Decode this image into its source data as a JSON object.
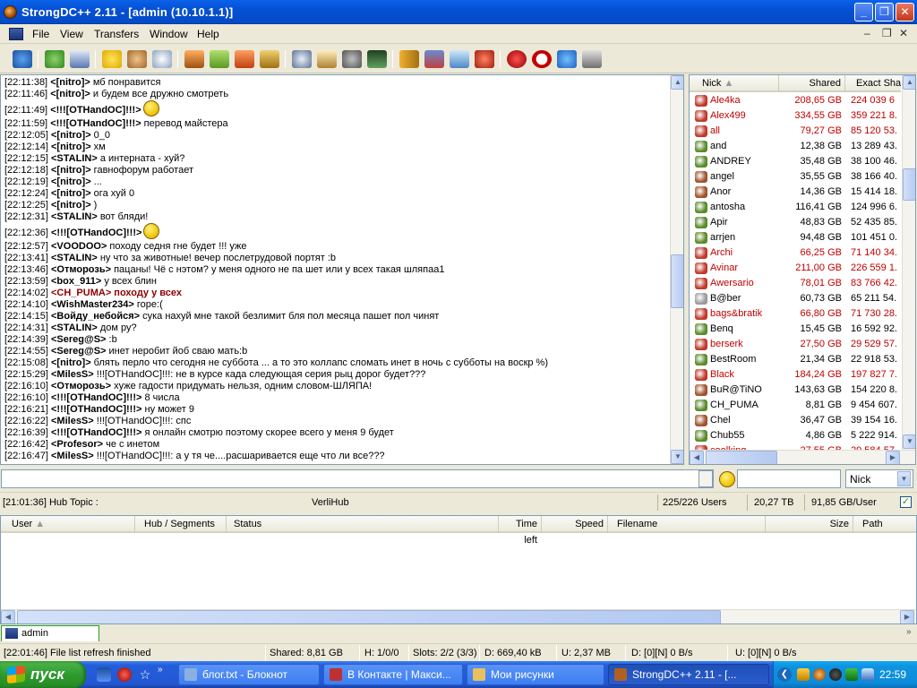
{
  "window": {
    "title": "StrongDC++ 2.11 - [admin (10.10.1.1)]",
    "controls": {
      "minimize": "_",
      "maximize": "❐",
      "close": "✕"
    }
  },
  "menu": {
    "items": [
      "File",
      "View",
      "Transfers",
      "Window",
      "Help"
    ],
    "mdi_controls": {
      "minimize": "–",
      "restore": "❐",
      "close": "✕"
    }
  },
  "toolbar": {
    "icons": [
      "connect-icon",
      "reconnect-icon",
      "follow-redirect-icon",
      "favorites-icon",
      "users-icon",
      "recents-icon",
      "queue-icon",
      "finished-icon",
      "uploads-icon",
      "finished-uploads-icon",
      "search-icon",
      "adl-search-icon",
      "search-spy-icon",
      "notepad-icon",
      "open-list-icon",
      "refresh-icon",
      "settings-icon",
      "network-stats-icon",
      "away-icon",
      "limiter-icon",
      "sysinfo-icon",
      "cdm-icon"
    ]
  },
  "chat": {
    "lines": [
      {
        "time": "[22:11:38]",
        "nick": "<[nitro]>",
        "text": " мб понравится"
      },
      {
        "time": "[22:11:46]",
        "nick": "<[nitro]>",
        "text": " и будем все дружно смотреть"
      },
      {
        "time": "[22:11:49]",
        "nick": "<!!![OTHandOC]!!!>",
        "text": "",
        "smiley": true
      },
      {
        "time": "[22:11:59]",
        "nick": "<!!![OTHandOC]!!!>",
        "text": " перевод майстера"
      },
      {
        "time": "[22:12:05]",
        "nick": "<[nitro]>",
        "text": " 0_0"
      },
      {
        "time": "[22:12:14]",
        "nick": "<[nitro]>",
        "text": " хм"
      },
      {
        "time": "[22:12:15]",
        "nick": "<STALIN>",
        "text": " а интерната - хуй?"
      },
      {
        "time": "[22:12:18]",
        "nick": "<[nitro]>",
        "text": " гавнофорум работает"
      },
      {
        "time": "[22:12:19]",
        "nick": "<[nitro]>",
        "text": " ..."
      },
      {
        "time": "[22:12:24]",
        "nick": "<[nitro]>",
        "text": " ога хуй 0"
      },
      {
        "time": "[22:12:25]",
        "nick": "<[nitro]>",
        "text": " )"
      },
      {
        "time": "[22:12:31]",
        "nick": "<STALIN>",
        "text": " вот бляди!"
      },
      {
        "time": "[22:12:36]",
        "nick": "<!!![OTHandOC]!!!>",
        "text": "",
        "smiley": true
      },
      {
        "time": "[22:12:57]",
        "nick": "<VOODOO>",
        "text": " походу седня гне будет !!! уже"
      },
      {
        "time": "[22:13:41]",
        "nick": "<STALIN>",
        "text": " ну что за животные! вечер послетрудовой портят :b"
      },
      {
        "time": "[22:13:46]",
        "nick": "<Отморозь>",
        "text": " пацаны! Чё с нэтом? у меня одного не па шет или у всех такая шляпаа1"
      },
      {
        "time": "[22:13:59]",
        "nick": "<box_911>",
        "text": " у всех блин"
      },
      {
        "time": "[22:14:02]",
        "nick": "<CH_PUMA>",
        "text": " походу у всех",
        "highlight": true
      },
      {
        "time": "[22:14:10]",
        "nick": "<WishMaster234>",
        "text": " горе:("
      },
      {
        "time": "[22:14:15]",
        "nick": "<Войду_небойся>",
        "text": " сука нахуй мне такой безлимит бля пол месяца пашет пол чинят"
      },
      {
        "time": "[22:14:31]",
        "nick": "<STALIN>",
        "text": " дом ру?"
      },
      {
        "time": "[22:14:39]",
        "nick": "<Sereg@S>",
        "text": " :b"
      },
      {
        "time": "[22:14:55]",
        "nick": "<Sereg@S>",
        "text": " инет неробит йоб сваю мать:b"
      },
      {
        "time": "[22:15:08]",
        "nick": "<[nitro]>",
        "text": " блять перло что сегодня не суббота ... а то это коллапс сломать инет в ночь с субботы на воскр %)"
      },
      {
        "time": "[22:15:29]",
        "nick": "<MilesS>",
        "text": " !!![OTHandOC]!!!: не в курсе када следующая серия рыц дорог будет???"
      },
      {
        "time": "[22:16:10]",
        "nick": "<Отморозь>",
        "text": " хуже гадости придумать нельзя, одним словом-ШЛЯПА!"
      },
      {
        "time": "[22:16:10]",
        "nick": "<!!![OTHandOC]!!!>",
        "text": " 8 числа"
      },
      {
        "time": "[22:16:21]",
        "nick": "<!!![OTHandOC]!!!>",
        "text": " ну может 9"
      },
      {
        "time": "[22:16:22]",
        "nick": "<MilesS>",
        "text": " !!![OTHandOC]!!!: спс"
      },
      {
        "time": "[22:16:39]",
        "nick": "<!!![OTHandOC]!!!>",
        "text": " я онлайн смотрю поэтому скорее всего у меня 9 будет"
      },
      {
        "time": "[22:16:42]",
        "nick": "<Profesor>",
        "text": " че с инетом"
      },
      {
        "time": "[22:16:47]",
        "nick": "<MilesS>",
        "text": " !!![OTHandOC]!!!: а у тя че....расшаривается еще что ли все???"
      }
    ]
  },
  "userlist": {
    "columns": {
      "nick": "Nick",
      "shared": "Shared",
      "exact": "Exact Sha"
    },
    "users": [
      {
        "nick": "Ale4ka",
        "shared": "208,65 GB",
        "exact": "224 039 6",
        "color": "#c00000",
        "icon": "#c0392b"
      },
      {
        "nick": "Alex499",
        "shared": "334,55 GB",
        "exact": "359 221 8.",
        "color": "#c00000",
        "icon": "#c0392b"
      },
      {
        "nick": "all",
        "shared": "79,27 GB",
        "exact": "85 120 53.",
        "color": "#c00000",
        "icon": "#c0392b"
      },
      {
        "nick": "and",
        "shared": "12,38 GB",
        "exact": "13 289 43.",
        "color": "#000000",
        "icon": "#5a8a2a"
      },
      {
        "nick": "ANDREY",
        "shared": "35,48 GB",
        "exact": "38 100 46.",
        "color": "#000000",
        "icon": "#5a8a2a"
      },
      {
        "nick": "angel",
        "shared": "35,55 GB",
        "exact": "38 166 40.",
        "color": "#000000",
        "icon": "#a0522d"
      },
      {
        "nick": "Anor",
        "shared": "14,36 GB",
        "exact": "15 414 18.",
        "color": "#000000",
        "icon": "#a0522d"
      },
      {
        "nick": "antosha",
        "shared": "116,41 GB",
        "exact": "124 996 6.",
        "color": "#000000",
        "icon": "#5a8a2a"
      },
      {
        "nick": "Apir",
        "shared": "48,83 GB",
        "exact": "52 435 85.",
        "color": "#000000",
        "icon": "#5a8a2a"
      },
      {
        "nick": "arrjen",
        "shared": "94,48 GB",
        "exact": "101 451 0.",
        "color": "#000000",
        "icon": "#5a8a2a"
      },
      {
        "nick": "Archi",
        "shared": "66,25 GB",
        "exact": "71 140 34.",
        "color": "#c00000",
        "icon": "#c0392b"
      },
      {
        "nick": "Avinar",
        "shared": "211,00 GB",
        "exact": "226 559 1.",
        "color": "#c00000",
        "icon": "#c0392b"
      },
      {
        "nick": "Awersario",
        "shared": "78,01 GB",
        "exact": "83 766 42.",
        "color": "#c00000",
        "icon": "#c0392b"
      },
      {
        "nick": "B@ber",
        "shared": "60,73 GB",
        "exact": "65 211 54.",
        "color": "#000000",
        "icon": "#9a9a9a"
      },
      {
        "nick": "bags&bratik",
        "shared": "66,80 GB",
        "exact": "71 730 28.",
        "color": "#c00000",
        "icon": "#c0392b"
      },
      {
        "nick": "Benq",
        "shared": "15,45 GB",
        "exact": "16 592 92.",
        "color": "#000000",
        "icon": "#5a8a2a"
      },
      {
        "nick": "berserk",
        "shared": "27,50 GB",
        "exact": "29 529 57.",
        "color": "#c00000",
        "icon": "#c0392b"
      },
      {
        "nick": "BestRoom",
        "shared": "21,34 GB",
        "exact": "22 918 53.",
        "color": "#000000",
        "icon": "#5a8a2a"
      },
      {
        "nick": "Black",
        "shared": "184,24 GB",
        "exact": "197 827 7.",
        "color": "#c00000",
        "icon": "#c0392b"
      },
      {
        "nick": "BuR@TiNO",
        "shared": "143,63 GB",
        "exact": "154 220 8.",
        "color": "#000000",
        "icon": "#a0522d"
      },
      {
        "nick": "CH_PUMA",
        "shared": "8,81 GB",
        "exact": "9 454 607.",
        "color": "#000000",
        "icon": "#5a8a2a"
      },
      {
        "nick": "Chel",
        "shared": "36,47 GB",
        "exact": "39 154 16.",
        "color": "#000000",
        "icon": "#a0522d"
      },
      {
        "nick": "Chub55",
        "shared": "4,86 GB",
        "exact": "5 222 914.",
        "color": "#000000",
        "icon": "#5a8a2a"
      },
      {
        "nick": "coolking",
        "shared": "27,55 GB",
        "exact": "29 584 57",
        "color": "#c00000",
        "icon": "#c0392b"
      }
    ]
  },
  "input": {
    "message_value": "",
    "filter_value": "",
    "filter_select": "Nick"
  },
  "hub_status": {
    "topic": "[21:01:36] Hub Topic :",
    "hub_name": "VerliHub",
    "users": "225/226 Users",
    "total_share": "20,27 TB",
    "per_user": "91,85 GB/User"
  },
  "transfers": {
    "columns": {
      "user": "User",
      "hub": "Hub / Segments",
      "status": "Status",
      "time_left": "Time left",
      "speed": "Speed",
      "filename": "Filename",
      "size": "Size",
      "path": "Path"
    }
  },
  "tabs": {
    "active": "admin (10.10.1.1)"
  },
  "statusbar": {
    "message": "[22:01:46] File list refresh finished",
    "shared": "Shared: 8,81 GB",
    "hubs": "H: 1/0/0",
    "slots": "Slots: 2/2 (3/3)",
    "download": "D: 669,40 kB",
    "upload": "U: 2,37 MB",
    "dl_speed": "D: [0][N] 0 B/s",
    "ul_speed": "U: [0][N] 0 B/s"
  },
  "taskbar": {
    "start": "пуск",
    "tasks": [
      {
        "label": "блог.txt - Блокнот",
        "active": false
      },
      {
        "label": "В Контакте | Макси...",
        "active": false
      },
      {
        "label": "Мои рисунки",
        "active": false
      },
      {
        "label": "StrongDC++ 2.11 - [...",
        "active": true
      }
    ],
    "clock": "22:59"
  },
  "colors": {
    "titlebar": "#0550d6",
    "nick_red": "#c00000",
    "highlight_nick": "#8b0000",
    "taskbar": "#245edb",
    "tray": "#0b8cdb"
  }
}
